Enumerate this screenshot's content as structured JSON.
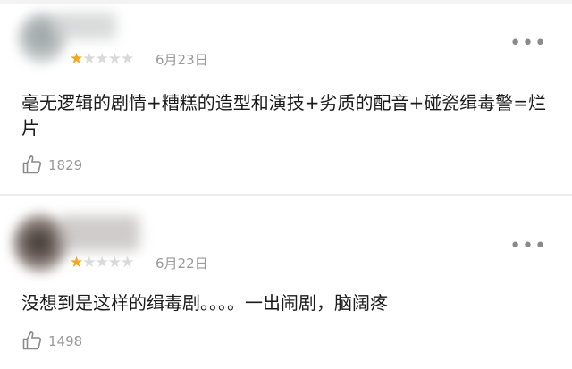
{
  "comments": [
    {
      "rating": "1/5",
      "date": "6月23日",
      "text": "毫无逻辑的剧情+糟糕的造型和演技+劣质的配音+碰瓷缉毒警=烂片",
      "likes": "1829",
      "avatar_icon": "avatar-blurred",
      "more_icon": "more-dots-icon",
      "like_icon": "thumbs-up-icon"
    },
    {
      "rating": "1/5",
      "date": "6月22日",
      "text": "没想到是这样的缉毒剧。。。。一出闹剧，脑阔疼",
      "likes": "1498",
      "avatar_icon": "avatar-blurred",
      "more_icon": "more-dots-icon",
      "like_icon": "thumbs-up-icon"
    }
  ],
  "colors": {
    "star_filled": "#f5a623",
    "star_empty": "#d9d9d9",
    "muted_text": "#9a9a9a",
    "body_text": "#1a1a1a"
  }
}
